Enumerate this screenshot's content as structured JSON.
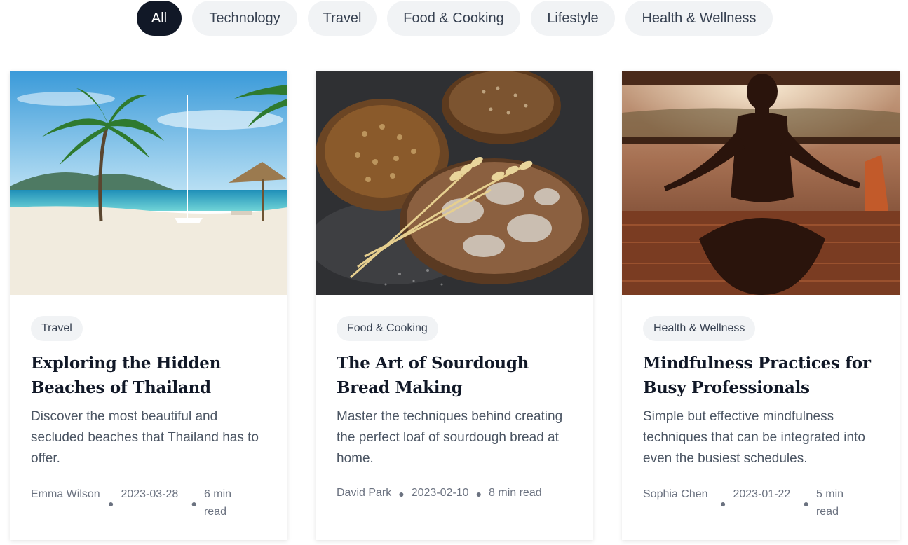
{
  "filters": [
    {
      "label": "All",
      "active": true
    },
    {
      "label": "Technology",
      "active": false
    },
    {
      "label": "Travel",
      "active": false
    },
    {
      "label": "Food & Cooking",
      "active": false
    },
    {
      "label": "Lifestyle",
      "active": false
    },
    {
      "label": "Health & Wellness",
      "active": false
    }
  ],
  "posts": [
    {
      "category": "Travel",
      "title": "Exploring the Hidden Beaches of Thailand",
      "excerpt": "Discover the most beautiful and secluded beaches that Thailand has to offer.",
      "author": "Emma Wilson",
      "date": "2023-03-28",
      "read_time": "6 min read",
      "image": "beach-photo"
    },
    {
      "category": "Food & Cooking",
      "title": "The Art of Sourdough Bread Making",
      "excerpt": "Master the techniques behind creating the perfect loaf of sourdough bread at home.",
      "author": "David Park",
      "date": "2023-02-10",
      "read_time": "8 min read",
      "image": "bread-photo"
    },
    {
      "category": "Health & Wellness",
      "title": "Mindfulness Practices for Busy Professionals",
      "excerpt": "Simple but effective mindfulness techniques that can be integrated into even the busiest schedules.",
      "author": "Sophia Chen",
      "date": "2023-01-22",
      "read_time": "5 min read",
      "image": "meditation-photo"
    }
  ],
  "colors": {
    "active_pill": "#111827",
    "pill_bg": "#f1f3f5",
    "text_muted": "#4b5563"
  }
}
